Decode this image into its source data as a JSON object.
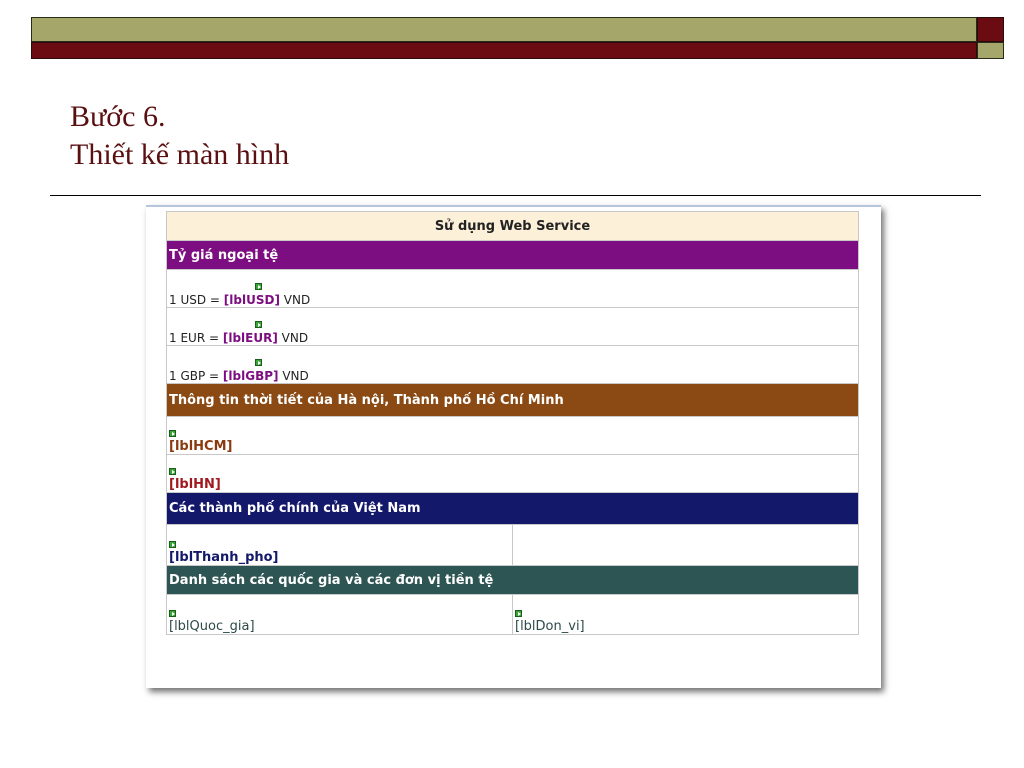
{
  "slide": {
    "title_line1": "Bước 6.",
    "title_line2": "Thiết kế màn hình"
  },
  "designer": {
    "header": "Sử dụng Web Service",
    "exchange": {
      "title": "Tỷ giá ngoại tệ",
      "rows": [
        {
          "prefix": "1 USD =",
          "label": "[lblUSD]",
          "suffix": "VND"
        },
        {
          "prefix": "1 EUR =",
          "label": "[lblEUR]",
          "suffix": "VND"
        },
        {
          "prefix": "1 GBP =",
          "label": "[lblGBP]",
          "suffix": "VND"
        }
      ]
    },
    "weather": {
      "title": "Thông tin thời tiết của Hà nội, Thành phố Hồ Chí Minh",
      "hcm_label": "[lblHCM]",
      "hn_label": "[lblHN]"
    },
    "cities": {
      "title": "Các thành phố chính của Việt Nam",
      "label": "[lblThanh_pho]"
    },
    "countries": {
      "title": "Danh sách các quốc gia và các đơn vị tiền tệ",
      "country_label": "[lblQuoc_gia]",
      "unit_label": "[lblDon_vi]"
    }
  },
  "colors": {
    "olive": "#a4a66a",
    "maroon": "#6b0b12",
    "purple": "#7d0e82",
    "brown": "#8b4a13",
    "navy": "#14186a",
    "slate": "#2d5553",
    "marker_green": "#37a637"
  }
}
